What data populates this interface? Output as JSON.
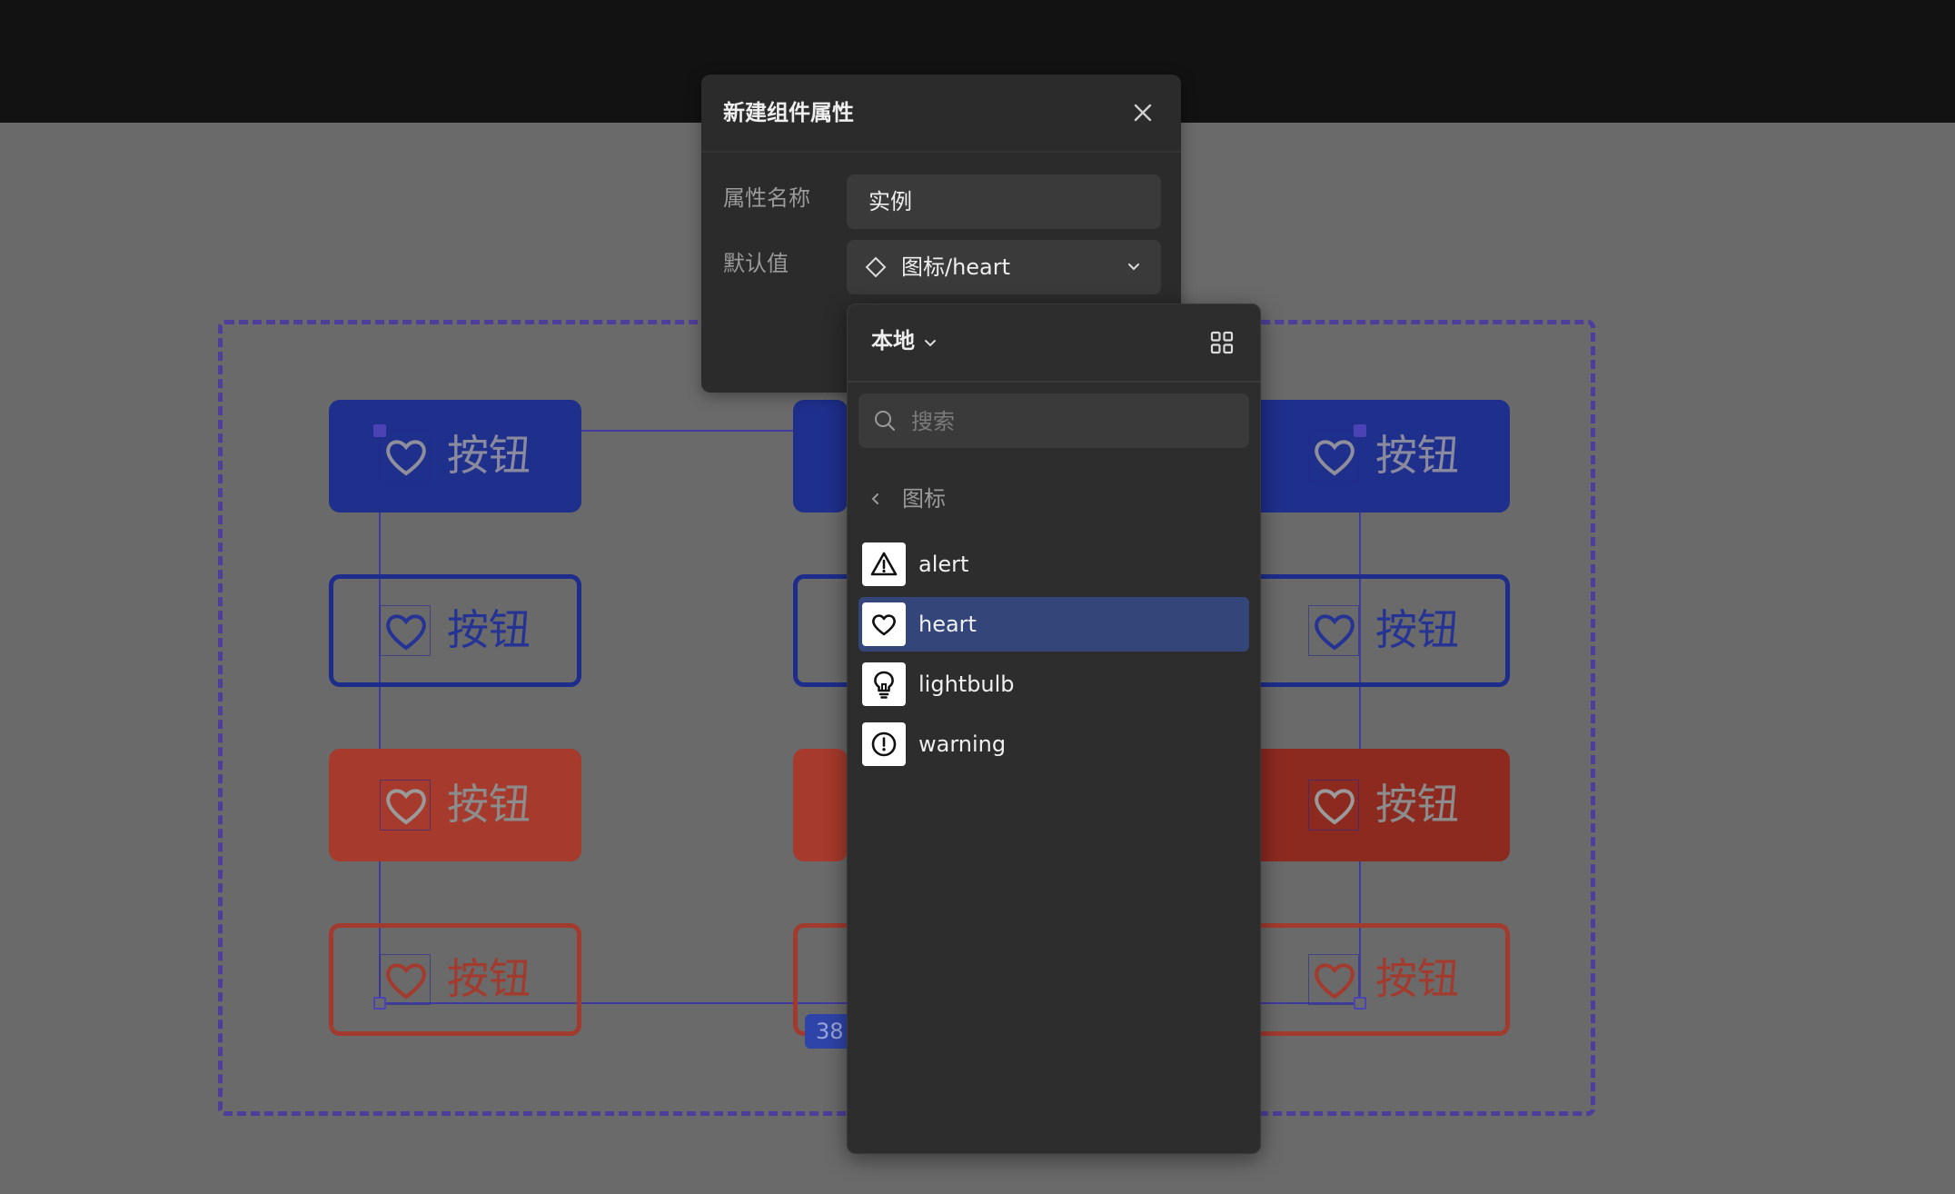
{
  "canvas": {
    "button_label": "按钮",
    "dimension_badge": "38",
    "colors": {
      "primary": "#1f2f8c",
      "danger": "#a63a2c",
      "selection": "#4f3d9c"
    }
  },
  "dialog": {
    "title": "新建组件属性",
    "name_label": "属性名称",
    "name_value": "实例",
    "default_label": "默认值",
    "default_value": "图标/heart"
  },
  "picker": {
    "source": "本地",
    "search_placeholder": "搜索",
    "folder": "图标",
    "items": [
      {
        "name": "alert",
        "icon": "alert-triangle-icon",
        "selected": false
      },
      {
        "name": "heart",
        "icon": "heart-icon",
        "selected": true
      },
      {
        "name": "lightbulb",
        "icon": "lightbulb-icon",
        "selected": false
      },
      {
        "name": "warning",
        "icon": "warning-circle-icon",
        "selected": false
      }
    ]
  }
}
